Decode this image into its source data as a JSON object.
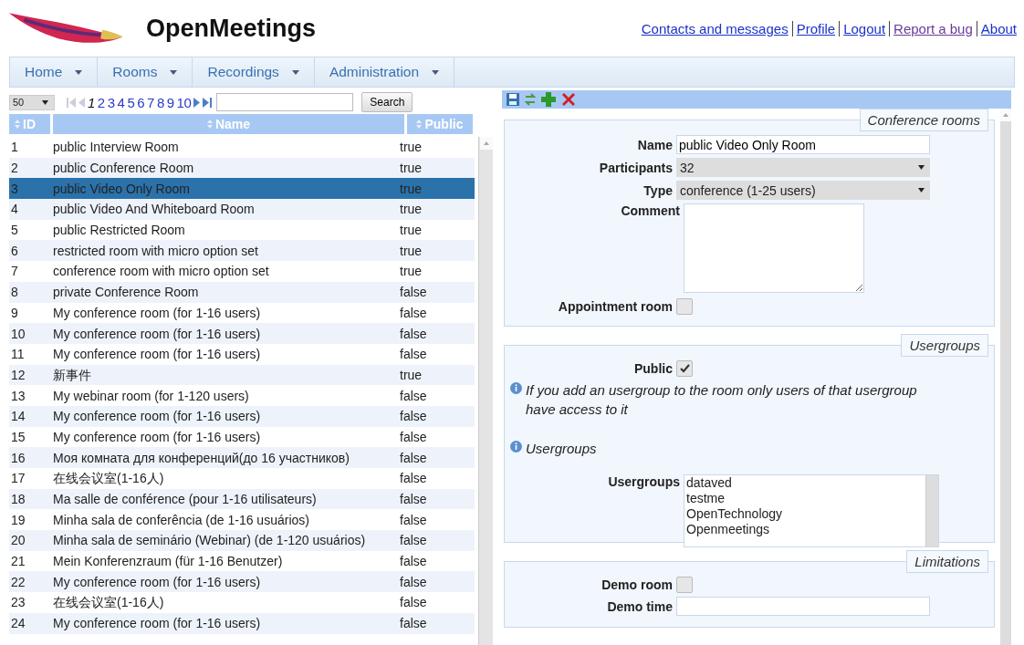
{
  "header": {
    "title": "OpenMeetings",
    "links": [
      {
        "label": "Contacts and messages",
        "visited": false
      },
      {
        "label": "Profile",
        "visited": false
      },
      {
        "label": "Logout",
        "visited": false
      },
      {
        "label": "Report a bug",
        "visited": true
      },
      {
        "label": "About",
        "visited": false
      }
    ]
  },
  "menu": [
    {
      "label": "Home"
    },
    {
      "label": "Rooms"
    },
    {
      "label": "Recordings"
    },
    {
      "label": "Administration"
    }
  ],
  "pager": {
    "page_size": "50",
    "pages": [
      {
        "label": "1",
        "selected": true
      },
      {
        "label": "2",
        "selected": false
      },
      {
        "label": "3",
        "selected": false
      },
      {
        "label": "4",
        "selected": false
      },
      {
        "label": "5",
        "selected": false
      },
      {
        "label": "6",
        "selected": false
      },
      {
        "label": "7",
        "selected": false
      },
      {
        "label": "8",
        "selected": false
      },
      {
        "label": "9",
        "selected": false
      },
      {
        "label": "10",
        "selected": false
      }
    ],
    "search_button": "Search"
  },
  "table": {
    "columns": [
      "ID",
      "Name",
      "Public"
    ],
    "rows": [
      {
        "id": "1",
        "name": "public Interview Room",
        "public": "true",
        "selected": false
      },
      {
        "id": "2",
        "name": "public Conference Room",
        "public": "true",
        "selected": false
      },
      {
        "id": "3",
        "name": "public Video Only Room",
        "public": "true",
        "selected": true
      },
      {
        "id": "4",
        "name": "public Video And Whiteboard Room",
        "public": "true",
        "selected": false
      },
      {
        "id": "5",
        "name": "public Restricted Room",
        "public": "true",
        "selected": false
      },
      {
        "id": "6",
        "name": "restricted room with micro option set",
        "public": "true",
        "selected": false
      },
      {
        "id": "7",
        "name": "conference room with micro option set",
        "public": "true",
        "selected": false
      },
      {
        "id": "8",
        "name": "private Conference Room",
        "public": "false",
        "selected": false
      },
      {
        "id": "9",
        "name": "My conference room (for 1-16 users)",
        "public": "false",
        "selected": false
      },
      {
        "id": "10",
        "name": "My conference room (for 1-16 users)",
        "public": "false",
        "selected": false
      },
      {
        "id": "11",
        "name": "My conference room (for 1-16 users)",
        "public": "false",
        "selected": false
      },
      {
        "id": "12",
        "name": "新事件",
        "public": "true",
        "selected": false
      },
      {
        "id": "13",
        "name": "My webinar room (for 1-120 users)",
        "public": "false",
        "selected": false
      },
      {
        "id": "14",
        "name": "My conference room (for 1-16 users)",
        "public": "false",
        "selected": false
      },
      {
        "id": "15",
        "name": "My conference room (for 1-16 users)",
        "public": "false",
        "selected": false
      },
      {
        "id": "16",
        "name": "Моя комната для конференций(до 16 участников)",
        "public": "false",
        "selected": false
      },
      {
        "id": "17",
        "name": "在线会议室(1-16人)",
        "public": "false",
        "selected": false
      },
      {
        "id": "18",
        "name": "Ma salle de conférence (pour 1-16 utilisateurs)",
        "public": "false",
        "selected": false
      },
      {
        "id": "19",
        "name": "Minha sala de conferência (de 1-16 usuários)",
        "public": "false",
        "selected": false
      },
      {
        "id": "20",
        "name": "Minha sala de seminário (Webinar) (de 1-120 usuários)",
        "public": "false",
        "selected": false
      },
      {
        "id": "21",
        "name": "Mein Konferenzraum (für 1-16 Benutzer)",
        "public": "false",
        "selected": false
      },
      {
        "id": "22",
        "name": "My conference room (for 1-16 users)",
        "public": "false",
        "selected": false
      },
      {
        "id": "23",
        "name": "在线会议室(1-16人)",
        "public": "false",
        "selected": false
      },
      {
        "id": "24",
        "name": "My conference room (for 1-16 users)",
        "public": "false",
        "selected": false
      }
    ]
  },
  "form": {
    "conference_rooms": {
      "legend": "Conference rooms",
      "name_label": "Name",
      "name_value": "public Video Only Room",
      "participants_label": "Participants",
      "participants_value": "32",
      "type_label": "Type",
      "type_value": "conference (1-25 users)",
      "comment_label": "Comment",
      "appointment_label": "Appointment room",
      "appointment_checked": false
    },
    "usergroups": {
      "legend": "Usergroups",
      "public_label": "Public",
      "public_checked": true,
      "info": "If you add an usergroup to the room only users of that usergroup have access to it",
      "info2": "Usergroups",
      "list_label": "Usergroups",
      "groups": [
        "dataved",
        "testme",
        "OpenTechnology",
        "Openmeetings"
      ]
    },
    "limitations": {
      "legend": "Limitations",
      "demo_room_label": "Demo room",
      "demo_room_checked": false,
      "demo_time_label": "Demo time"
    }
  }
}
